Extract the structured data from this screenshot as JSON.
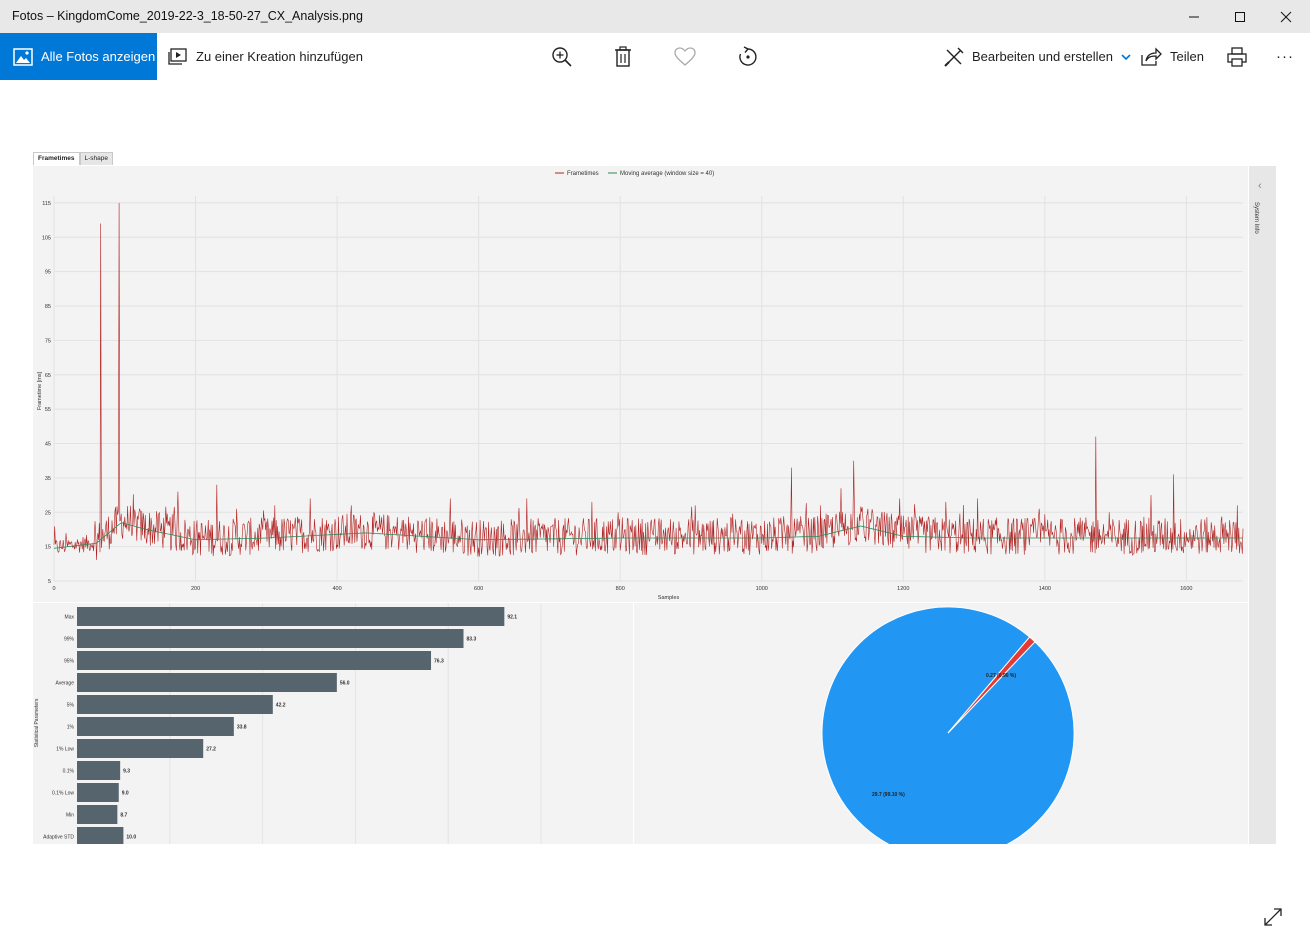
{
  "window": {
    "title": "Fotos – KingdomCome_2019-22-3_18-50-27_CX_Analysis.png",
    "minimize_icon": "minimize-icon",
    "maximize_icon": "maximize-icon",
    "close_icon": "close-icon"
  },
  "toolbar": {
    "all_photos_label": "Alle Fotos anzeigen",
    "add_creation_label": "Zu einer Kreation hinzufügen",
    "edit_create_label": "Bearbeiten und erstellen",
    "share_label": "Teilen",
    "more_label": "···",
    "accent_color": "#0078d7"
  },
  "image": {
    "tabs": [
      "Frametimes",
      "L-shape"
    ],
    "side_panel_label": "System Info"
  },
  "chart_data": [
    {
      "type": "line",
      "series": [
        {
          "name": "Frametimes",
          "color": "#b22222"
        },
        {
          "name": "Moving average (window size = 40)",
          "color": "#2e8b57"
        }
      ],
      "xlabel": "Samples",
      "ylabel": "Frametime [ms]",
      "xlim": [
        0,
        1680
      ],
      "ylim": [
        5,
        117
      ],
      "x_ticks": [
        0,
        200,
        400,
        600,
        800,
        1000,
        1200,
        1400,
        1600
      ],
      "y_ticks": [
        5,
        15,
        25,
        35,
        45,
        55,
        65,
        75,
        85,
        95,
        105,
        115
      ],
      "baseline_ms": 17.5,
      "moving_average_keypoints": [
        [
          0,
          14.5
        ],
        [
          60,
          16
        ],
        [
          95,
          22
        ],
        [
          130,
          20
        ],
        [
          200,
          17
        ],
        [
          300,
          17.5
        ],
        [
          440,
          19
        ],
        [
          520,
          18
        ],
        [
          600,
          17
        ],
        [
          800,
          17.5
        ],
        [
          1000,
          17.5
        ],
        [
          1080,
          18
        ],
        [
          1140,
          21
        ],
        [
          1200,
          18
        ],
        [
          1300,
          17.5
        ],
        [
          1680,
          17.5
        ]
      ],
      "spikes": [
        [
          66,
          109
        ],
        [
          92,
          115
        ],
        [
          175,
          31
        ],
        [
          230,
          33
        ],
        [
          258,
          26
        ],
        [
          312,
          27
        ],
        [
          362,
          29
        ],
        [
          420,
          27
        ],
        [
          560,
          29
        ],
        [
          668,
          29
        ],
        [
          760,
          28
        ],
        [
          906,
          27
        ],
        [
          1042,
          38
        ],
        [
          1083,
          27
        ],
        [
          1112,
          32
        ],
        [
          1130,
          40
        ],
        [
          1150,
          26
        ],
        [
          1195,
          29
        ],
        [
          1260,
          28
        ],
        [
          1305,
          29
        ],
        [
          1392,
          26
        ],
        [
          1472,
          47
        ],
        [
          1550,
          30
        ],
        [
          1582,
          36
        ],
        [
          1672,
          27
        ]
      ],
      "grid": true
    },
    {
      "type": "bar",
      "orientation": "horizontal",
      "ylabel": "Statistical Parameters",
      "categories": [
        "Max",
        "99%",
        "95%",
        "Average",
        "5%",
        "1%",
        "1% Low",
        "0.1%",
        "0.1% Low",
        "Min",
        "Adaptive STD"
      ],
      "values": [
        92.1,
        83.3,
        76.3,
        56.0,
        42.2,
        33.8,
        27.2,
        9.3,
        9.0,
        8.7,
        10.0
      ],
      "value_labels": [
        "92.1",
        "83.3",
        "76.3",
        "56.0",
        "42.2",
        "33.8",
        "27.2",
        "9.3",
        "9.0",
        "8.7",
        "10.0"
      ],
      "xlim": [
        0,
        100
      ],
      "bar_color": "#56646e"
    },
    {
      "type": "pie",
      "values": [
        29.7,
        0.27
      ],
      "labels": [
        "29.7 (99.10 %)",
        "0.27 (0.90 %)"
      ],
      "colors": [
        "#2196f3",
        "#e53935"
      ]
    }
  ]
}
